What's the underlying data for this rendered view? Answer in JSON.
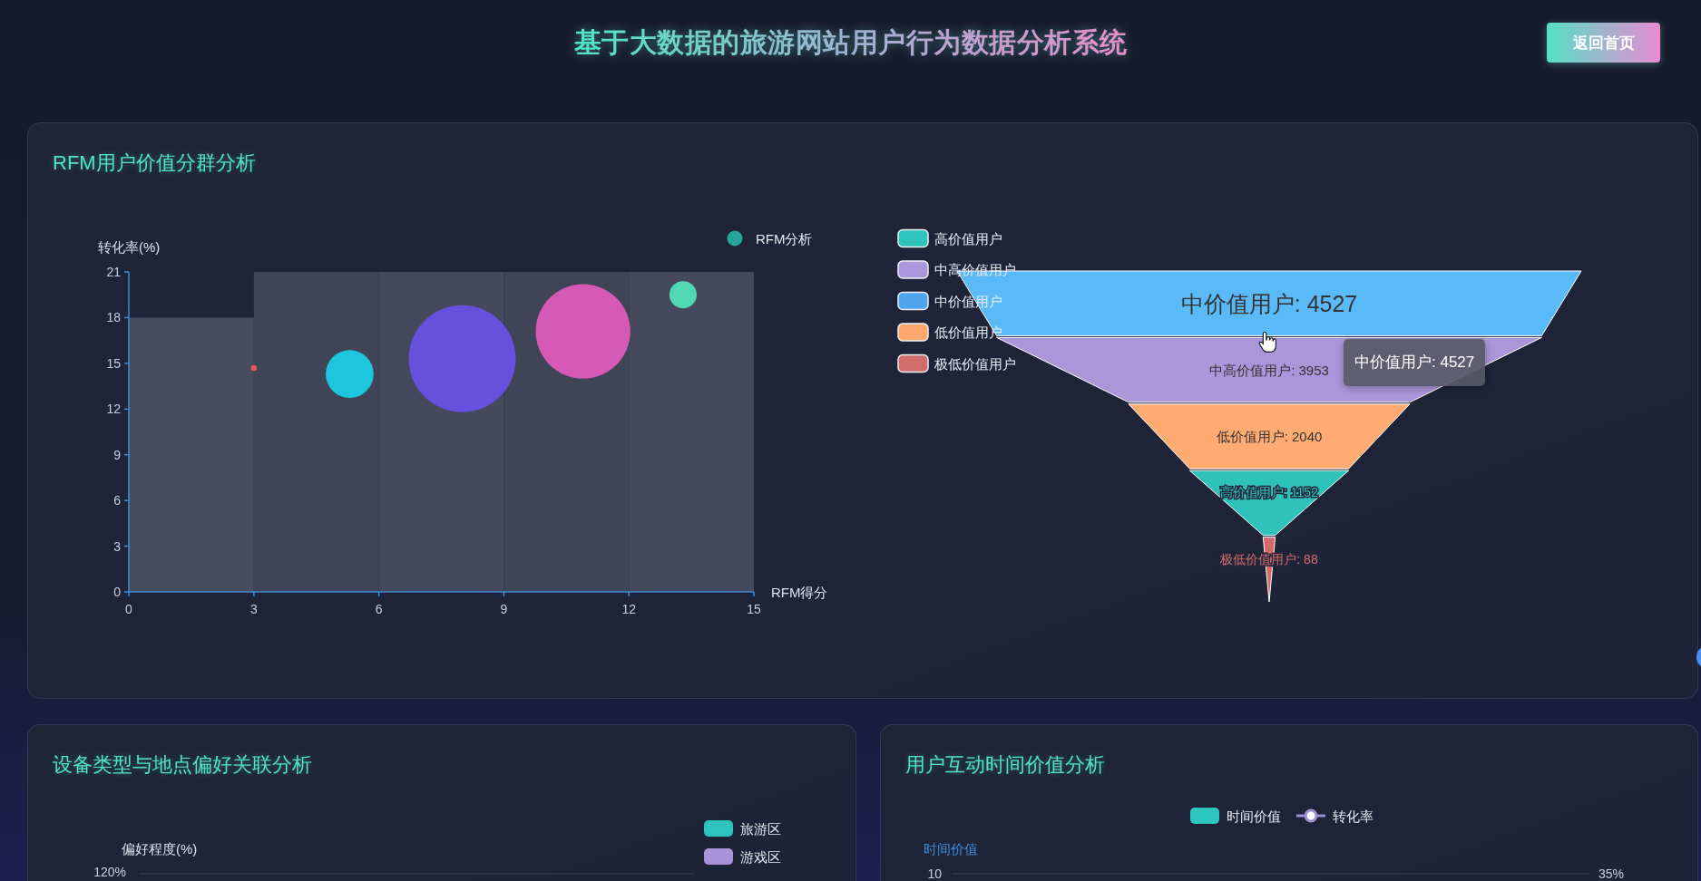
{
  "header": {
    "title": "基于大数据的旅游网站用户行为数据分析系统",
    "home_button": "返回首页"
  },
  "rfm_panel": {
    "title": "RFM用户价值分群分析",
    "scatter": {
      "legend": [
        {
          "label": "RFM分析",
          "color": "#26a69a"
        }
      ],
      "chart_data": {
        "type": "scatter",
        "xlabel": "RFM得分",
        "ylabel": "转化率(%)",
        "xlim": [
          0,
          15
        ],
        "ylim": [
          0,
          21
        ],
        "xticks": [
          0,
          3,
          6,
          9,
          12,
          15
        ],
        "yticks": [
          0,
          3,
          6,
          9,
          12,
          15,
          18,
          21
        ],
        "x": [
          3,
          5.3,
          8,
          10.9,
          13.3
        ],
        "series": [
          {
            "values": [
              14.7,
              14.3,
              15.3,
              17.1,
              19.5
            ],
            "sizes": [
              0.003,
              0.2,
              1,
              0.78,
              0.065
            ]
          }
        ]
      },
      "points": [
        {
          "color": "#e85b5b"
        },
        {
          "color": "#1cc6dc"
        },
        {
          "color": "#6650dc"
        },
        {
          "color": "#d65ab5"
        },
        {
          "color": "#4fd8b3"
        }
      ]
    },
    "funnel": {
      "legend": [
        {
          "label": "高价值用户",
          "color": "#2ec4be"
        },
        {
          "label": "中高价值用户",
          "color": "#ab98dc"
        },
        {
          "label": "中价值用户",
          "color": "#4fa6ee"
        },
        {
          "label": "低价值用户",
          "color": "#ffa86e"
        },
        {
          "label": "极低价值用户",
          "color": "#d26b6b"
        }
      ],
      "stages": [
        {
          "label": "中价值用户: 4527",
          "color": "#5ab9f7",
          "hovered": true,
          "kind": "dark"
        },
        {
          "label": "中高价值用户: 3953",
          "color": "#ab96da",
          "hovered": false,
          "kind": "dark"
        },
        {
          "label": "低价值用户: 2040",
          "color": "#ffab72",
          "hovered": false,
          "kind": "dark"
        },
        {
          "label": "高价值用户: 1152",
          "color": "#2ec2bb",
          "hovered": false,
          "kind": "outlined"
        },
        {
          "label": "极低价值用户: 88",
          "color": "#d46a6a",
          "hovered": false,
          "kind": "outlined"
        }
      ],
      "tooltip": "中价值用户: 4527"
    }
  },
  "device_panel": {
    "title": "设备类型与地点偏好关联分析",
    "legend": [
      {
        "label": "旅游区",
        "color": "#2ec4be"
      },
      {
        "label": "游戏区",
        "color": "#a992d8"
      }
    ],
    "y_axis_name": "偏好程度(%)",
    "y_ticks": [
      "120%"
    ]
  },
  "time_panel": {
    "title": "用户互动时间价值分析",
    "legend": [
      {
        "label": "时间价值",
        "kind": "bar",
        "color": "#2ec4be"
      },
      {
        "label": "转化率",
        "kind": "line",
        "color": "#9d8fd4"
      }
    ],
    "y_axis_name": "时间价值",
    "left_ticks": [
      "10"
    ],
    "right_ticks": [
      "35%"
    ]
  }
}
